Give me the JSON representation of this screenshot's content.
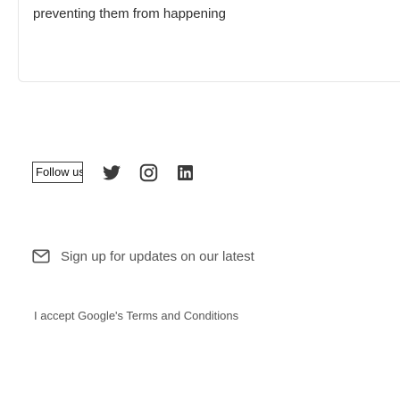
{
  "intro": {
    "text": "preventing them from happening"
  },
  "social": {
    "follow_label": "Follow us",
    "icons": [
      "twitter-icon",
      "instagram-icon",
      "linkedin-icon"
    ]
  },
  "signup": {
    "label": "Sign up for updates on our latest",
    "icon": "mail-icon"
  },
  "consent": {
    "text": "I accept Google's Terms and Conditions"
  },
  "colors": {
    "icon": "#3a3a3a",
    "border": "#e6e6e6",
    "muted_text": "#555555"
  }
}
